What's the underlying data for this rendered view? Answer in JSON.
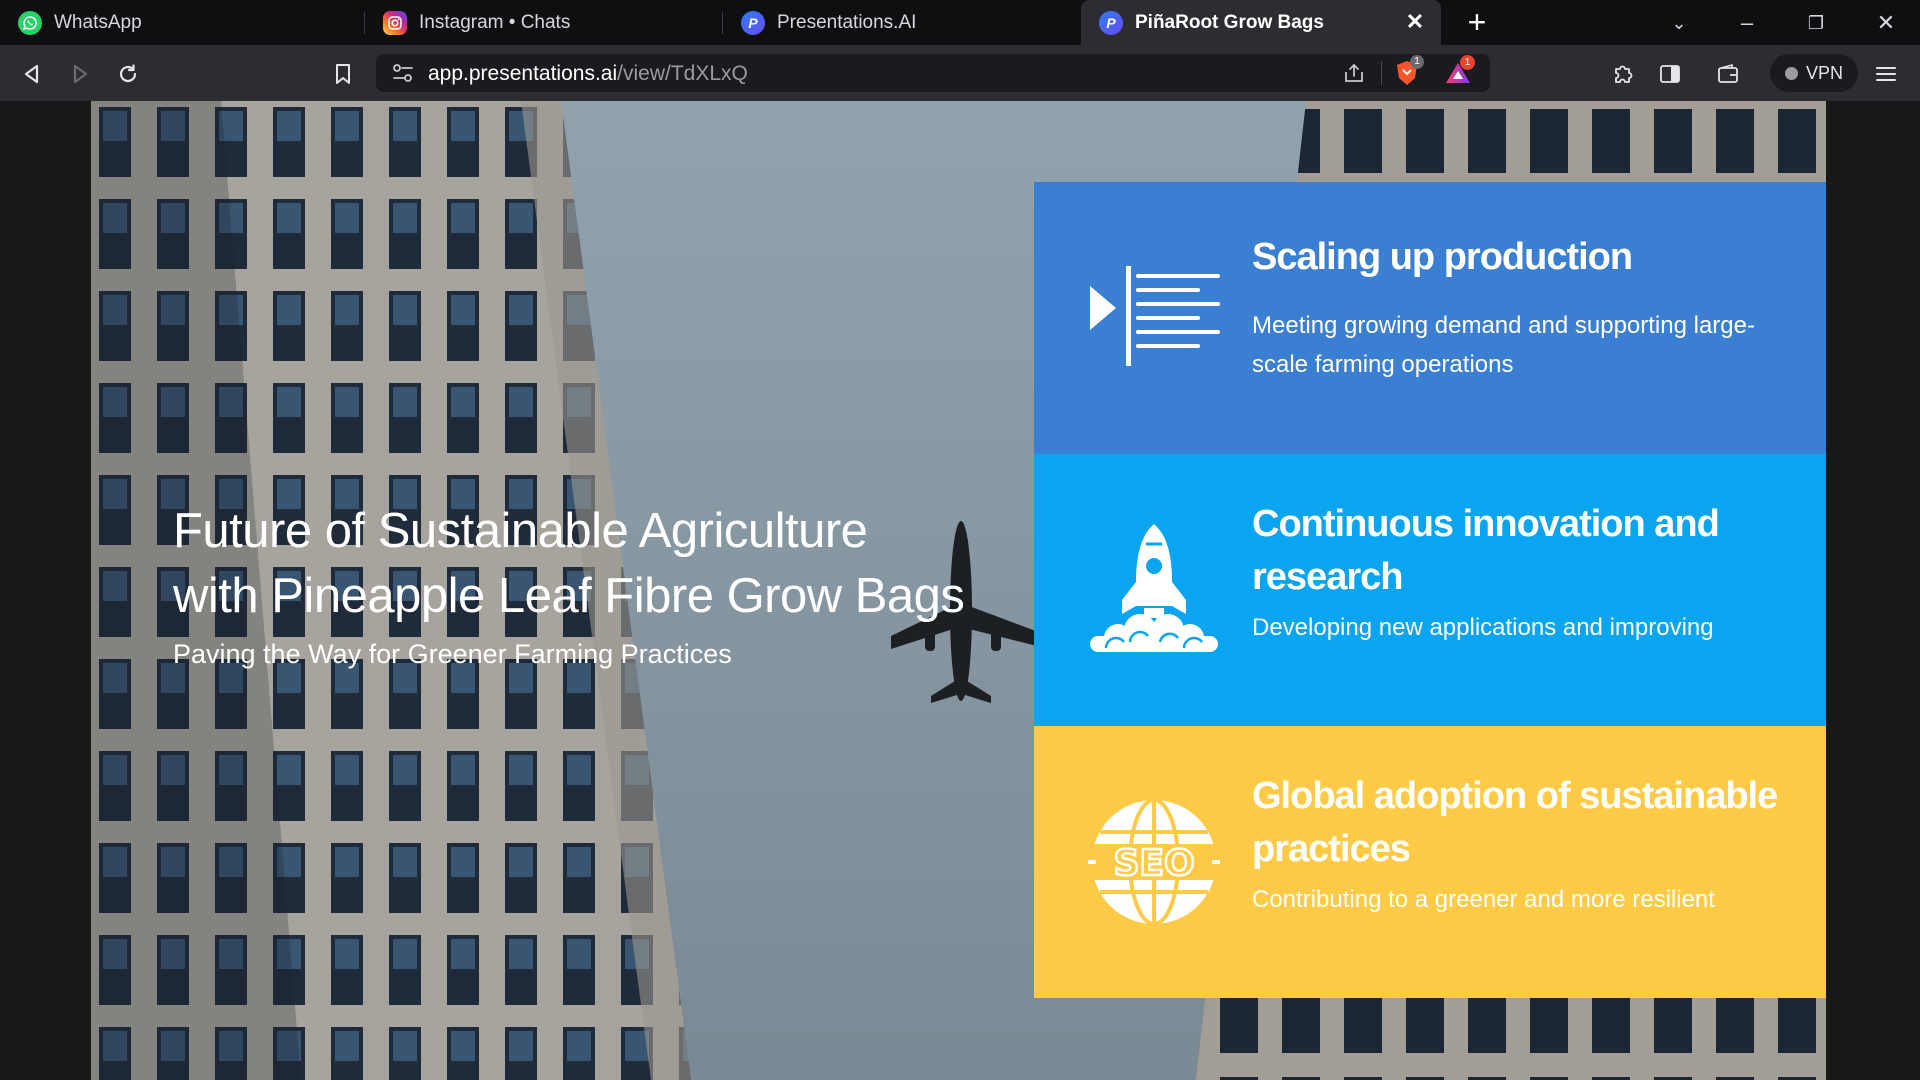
{
  "browser": {
    "tabs": [
      {
        "label": "WhatsApp",
        "favicon": "whatsapp-icon",
        "active": false
      },
      {
        "label": "Instagram • Chats",
        "favicon": "instagram-icon",
        "active": false
      },
      {
        "label": "Presentations.AI",
        "favicon": "presentations-ai-icon",
        "active": false
      },
      {
        "label": "PiñaRoot Grow Bags",
        "favicon": "presentations-ai-icon",
        "active": true
      }
    ],
    "url_domain": "app.presentations.ai",
    "url_path": "/view/TdXLxQ",
    "brave_badge": "1",
    "rewards_badge": "1",
    "vpn_label": "VPN",
    "colors": {
      "tabstrip": "#0f0f12",
      "toolbar": "#2c2c31",
      "badge": "#e8452c"
    }
  },
  "slide": {
    "title_line1": "Future of Sustainable Agriculture",
    "title_line2": "with Pineapple Leaf Fibre Grow Bags",
    "subtitle": "Paving the Way for Greener Farming Practices",
    "panels": [
      {
        "title": "Scaling up production",
        "description": "Meeting growing demand and supporting large-scale farming operations",
        "icon": "scaling-lines-icon",
        "color": "#3b7fd2"
      },
      {
        "title": "Continuous innovation and research",
        "description": "Developing new applications and improving",
        "icon": "rocket-icon",
        "color": "#0aa5f0"
      },
      {
        "title": "Global adoption of sustainable practices",
        "description": "Contributing to a greener and more resilient",
        "icon": "seo-globe-icon",
        "color": "#ffcb47"
      }
    ]
  }
}
